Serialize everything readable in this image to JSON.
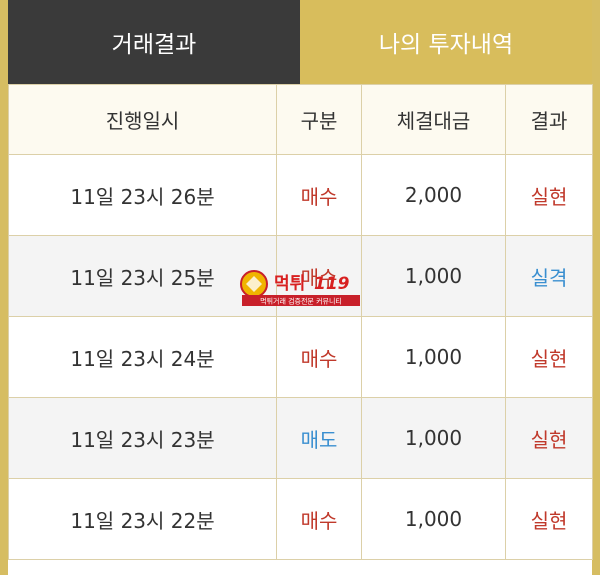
{
  "tabs": [
    {
      "label": "거래결과",
      "active": true
    },
    {
      "label": "나의 투자내역",
      "active": false
    }
  ],
  "table": {
    "headers": [
      "진행일시",
      "구분",
      "체결대금",
      "결과"
    ],
    "rows": [
      {
        "time": "11일 23시 26분",
        "type": "매수",
        "amount": "2,000",
        "result": "실현"
      },
      {
        "time": "11일 23시 25분",
        "type": "매수",
        "amount": "1,000",
        "result": "실격"
      },
      {
        "time": "11일 23시 24분",
        "type": "매수",
        "amount": "1,000",
        "result": "실현"
      },
      {
        "time": "11일 23시 23분",
        "type": "매도",
        "amount": "1,000",
        "result": "실현"
      },
      {
        "time": "11일 23시 22분",
        "type": "매수",
        "amount": "1,000",
        "result": "실현"
      }
    ]
  },
  "watermark": {
    "logo_text": "먹튀",
    "logo_number": "119",
    "tagline": "먹튀거래 검증전문 커뮤니티"
  },
  "colors": {
    "gold": "#d8bd5c",
    "dark_tab": "#3a3a3a",
    "buy_red": "#c0392b",
    "sell_blue": "#3a8fd0"
  }
}
